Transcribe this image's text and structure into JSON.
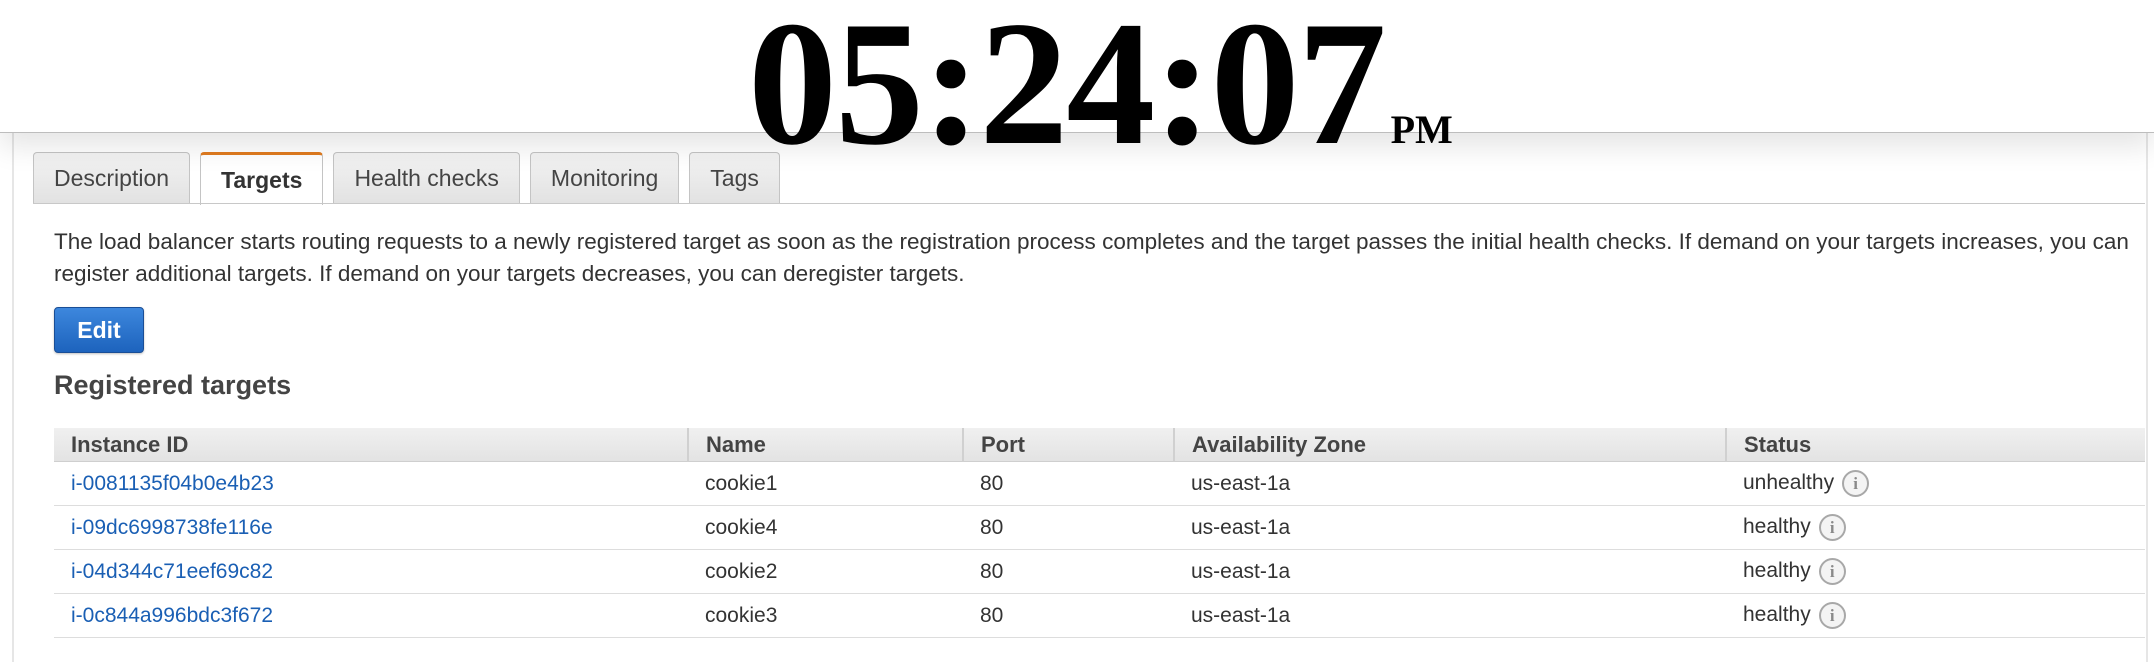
{
  "clock": {
    "time": "05:24:07",
    "ampm": "PM"
  },
  "tabs": [
    {
      "label": "Description",
      "active": false
    },
    {
      "label": "Targets",
      "active": true
    },
    {
      "label": "Health checks",
      "active": false
    },
    {
      "label": "Monitoring",
      "active": false
    },
    {
      "label": "Tags",
      "active": false
    }
  ],
  "intro_text": "The load balancer starts routing requests to a newly registered target as soon as the registration process completes and the target passes the initial health checks. If demand on your targets increases, you can register additional targets. If demand on your targets decreases, you can deregister targets.",
  "edit_button": {
    "label": "Edit",
    "color": "#2b74cf"
  },
  "section_title": "Registered targets",
  "table": {
    "columns": [
      "Instance ID",
      "Name",
      "Port",
      "Availability Zone",
      "Status"
    ],
    "rows": [
      {
        "instance_id": "i-0081135f04b0e4b23",
        "name": "cookie1",
        "port": "80",
        "zone": "us-east-1a",
        "status": "unhealthy"
      },
      {
        "instance_id": "i-09dc6998738fe116e",
        "name": "cookie4",
        "port": "80",
        "zone": "us-east-1a",
        "status": "healthy"
      },
      {
        "instance_id": "i-04d344c71eef69c82",
        "name": "cookie2",
        "port": "80",
        "zone": "us-east-1a",
        "status": "healthy"
      },
      {
        "instance_id": "i-0c844a996bdc3f672",
        "name": "cookie3",
        "port": "80",
        "zone": "us-east-1a",
        "status": "healthy"
      }
    ]
  },
  "icons": {
    "status_info": "info-icon",
    "info_glyph": "i"
  },
  "colors": {
    "active_tab_accent": "#e07b1f",
    "link": "#1a5fb4"
  }
}
